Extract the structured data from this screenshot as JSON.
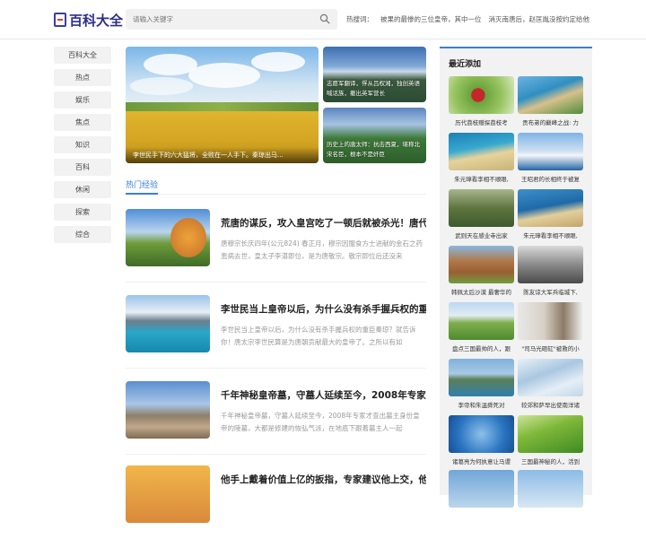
{
  "header": {
    "logo_text": "百科大全",
    "search_placeholder": "请输入关键字",
    "hot_label": "热搜词：",
    "hot_words": [
      "被果的最惨的三位皇帝，其中一位",
      "消灭南唐后，赵匡胤没按约定给他"
    ]
  },
  "nav": {
    "items": [
      "百科大全",
      "热点",
      "娱乐",
      "焦点",
      "知识",
      "百科",
      "休闲",
      "探索",
      "综合"
    ]
  },
  "hero": {
    "main_caption": "李世民手下的六大猛将，全败在一人手下。秦琼出马...",
    "side1_caption": "志愿军翻译，俘从吕权湘，独创英语喊话族，撤出英军营长",
    "side2_caption": "历史上的唐太师：抗击西夏，堪称北宋名臣，根本不是奸臣"
  },
  "section": {
    "title": "热门经验"
  },
  "articles": [
    {
      "title": "荒唐的谋反，攻入皇宫吃了一顿后就被杀光！唐代",
      "desc": "唐穆宗长庆四年(公元824) 春正月，穆宗因服食方士进献的金石之药患病去世，皇太子李湛即位，是为唐敬宗。敬宗即位后还没来"
    },
    {
      "title": "李世民当上皇帝以后，为什么没有杀手握兵权的重",
      "desc": "李世民当上皇帝以后，为什么没有杀手握兵权的重臣秦琼？就告诉你！唐太宗李世民算是为唐朝贡献最大的皇帝了。之所以有如"
    },
    {
      "title": "千年神秘皇帝墓，守墓人延续至今，2008年专家才",
      "desc": "千年神秘皇帝墓，守墓人延续至今，2008年专家才查出墓主身份皇帝的陵墓，大都是修建的恢弘气派，在地底下跟着墓主人一起"
    },
    {
      "title": "他手上戴着价值上亿的扳指，专家建议他上交，他6",
      "desc": ""
    }
  ],
  "sidebar": {
    "title": "最近添加",
    "items": [
      "历代荔枝赠探荔枝考",
      "贡布弟的巅峰之战: 力",
      "朱元璋看李相不顺眼,",
      "王昭君的长相终于被复",
      "武则天在感业寺出家",
      "朱元璋看李相不顺眼,",
      "韩佩太后沙漠 最奢华的",
      "陈友谅大军兵临城下,",
      "盘点三国最帅的人，跟",
      "\"司马光砸缸\"被救的小",
      "李帝和朱温舜死对",
      "较郊和萨早出使南洋诸",
      "诸葛亮为何执意让马谡",
      "三国最神秘的人，活到"
    ]
  },
  "colors": {
    "accent": "#3a7fd6",
    "logo": "#2c2f8a"
  }
}
